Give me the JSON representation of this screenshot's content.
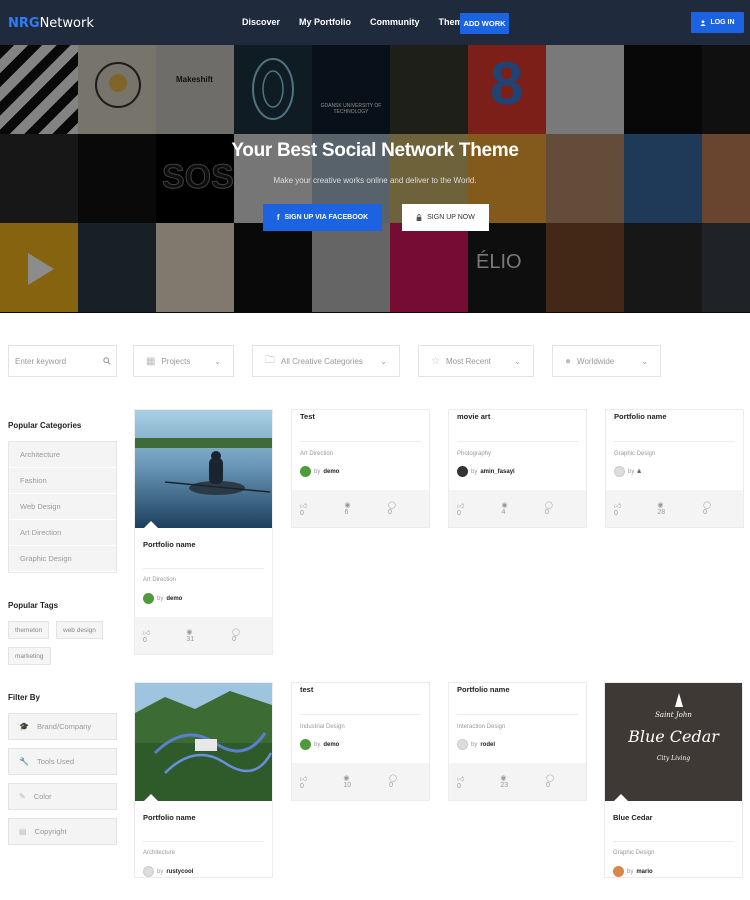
{
  "nav": {
    "logo_prefix": "NRG",
    "logo_suffix": "Network",
    "links": [
      "Discover",
      "My Portfolio",
      "Community",
      "Theme"
    ],
    "add_work": "ADD WORK",
    "login": "LOG IN"
  },
  "hero": {
    "title": "Your Best Social Network Theme",
    "subtitle": "Make your creative works online and deliver to the World.",
    "facebook_btn": "SIGN UP VIA FACEBOOK",
    "signup_btn": "SIGN UP NOW",
    "tile_texts": {
      "makeshift": "Makeshift",
      "gdansk": "GDANSK UNIVERSITY OF TECHNOLOGY",
      "sos": "SOS",
      "elio": "ÉLIO"
    }
  },
  "filters": {
    "keyword_placeholder": "Enter keyword",
    "projects": "Projects",
    "categories": "All Creative Categories",
    "sort": "Most Recent",
    "region": "Worldwide"
  },
  "sidebar": {
    "popular_categories_title": "Popular Categories",
    "categories": [
      "Architecture",
      "Fashion",
      "Web Design",
      "Art Direction",
      "Graphic Design"
    ],
    "popular_tags_title": "Popular Tags",
    "tags": [
      "themeton",
      "web design",
      "marketing"
    ],
    "filter_by_title": "Filter By",
    "filter_by": [
      "Brand/Company",
      "Tools Used",
      "Color",
      "Copyright"
    ]
  },
  "cards": [
    {
      "title": "Portfolio name",
      "category": "Art Direction",
      "by": "by",
      "author": "demo",
      "likes": "0",
      "views": "31",
      "comments": "0"
    },
    {
      "title": "Test",
      "category": "Art Direction",
      "by": "by",
      "author": "demo",
      "likes": "0",
      "views": "6",
      "comments": "0"
    },
    {
      "title": "movie art",
      "category": "Photography",
      "by": "by",
      "author": "amin_fasayi",
      "likes": "0",
      "views": "4",
      "comments": "0"
    },
    {
      "title": "Portfolio name",
      "category": "Graphic Design",
      "by": "by",
      "author": "a",
      "likes": "0",
      "views": "28",
      "comments": "0"
    },
    {
      "title": "Portfolio name",
      "category": "Architecture",
      "by": "by",
      "author": "rustycool"
    },
    {
      "title": "test",
      "category": "Industrial Design",
      "by": "by",
      "author": "demo",
      "likes": "0",
      "views": "10",
      "comments": "0"
    },
    {
      "title": "Portfolio name",
      "category": "Interaction Design",
      "by": "by",
      "author": "rodel",
      "likes": "0",
      "views": "23",
      "comments": "0"
    },
    {
      "title": "Blue Cedar",
      "category": "Graphic Design",
      "by": "by",
      "author": "mario",
      "image_text_top": "Saint John",
      "image_text_main": "Blue Cedar",
      "image_text_sub": "City Living"
    }
  ],
  "colors": {
    "nav_bg": "#1f2a3c",
    "accent": "#1b63e0",
    "logo_accent": "#2f7df6"
  }
}
